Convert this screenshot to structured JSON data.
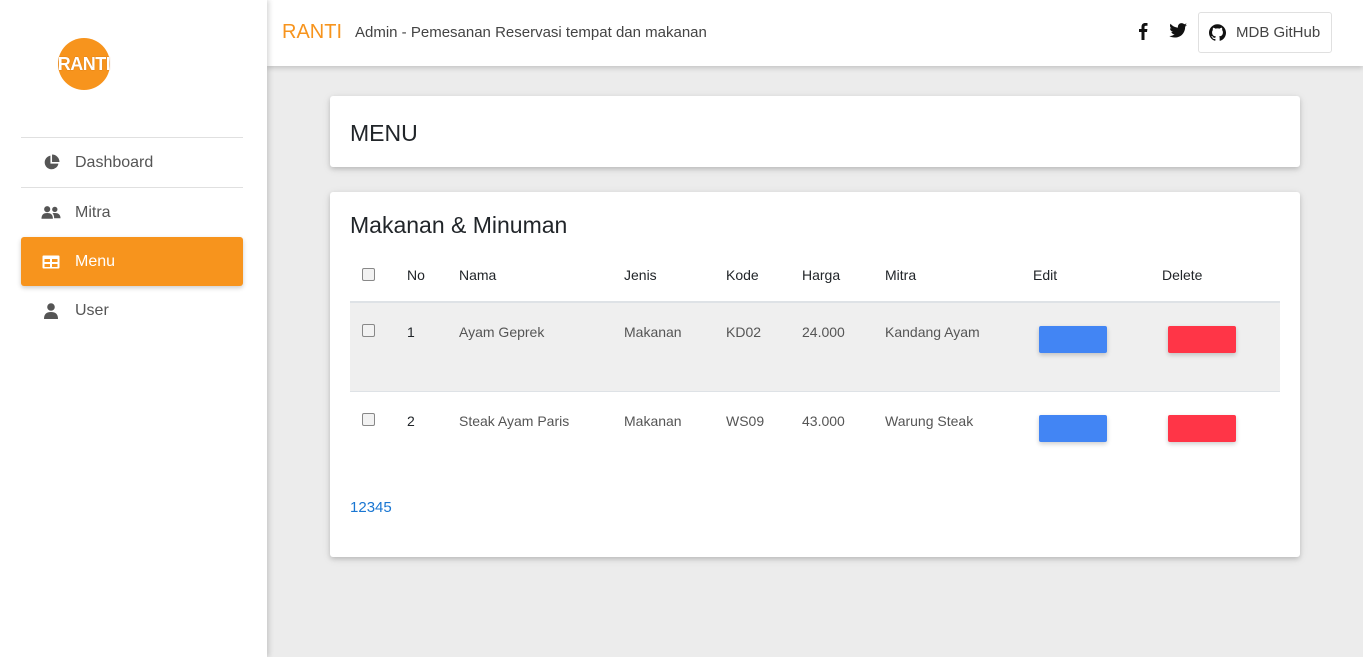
{
  "sidebar": {
    "logo_text": "RANTI",
    "items": [
      {
        "label": "Dashboard",
        "icon": "pie-chart-icon"
      },
      {
        "label": "Mitra",
        "icon": "users-icon"
      },
      {
        "label": "Menu",
        "icon": "table-icon",
        "active": true
      },
      {
        "label": "User",
        "icon": "user-icon"
      }
    ]
  },
  "topbar": {
    "brand": "RANTI",
    "title": "Admin - Pemesanan Reservasi tempat dan makanan",
    "github_label": "MDB GitHub"
  },
  "page": {
    "heading": "MENU"
  },
  "table_card": {
    "heading": "Makanan & Minuman",
    "columns": [
      "No",
      "Nama",
      "Jenis",
      "Kode",
      "Harga",
      "Mitra",
      "Edit",
      "Delete"
    ],
    "rows": [
      {
        "no": "1",
        "nama": "Ayam Geprek",
        "jenis": "Makanan",
        "kode": "KD02",
        "harga": "24.000",
        "mitra": "Kandang Ayam"
      },
      {
        "no": "2",
        "nama": "Steak Ayam Paris",
        "jenis": "Makanan",
        "kode": "WS09",
        "harga": "43.000",
        "mitra": "Warung Steak"
      }
    ],
    "pagination": [
      "1",
      "2",
      "3",
      "4",
      "5"
    ]
  },
  "colors": {
    "accent": "#f7941d",
    "edit": "#4285f4",
    "delete": "#ff3547",
    "link": "#1976d2"
  }
}
